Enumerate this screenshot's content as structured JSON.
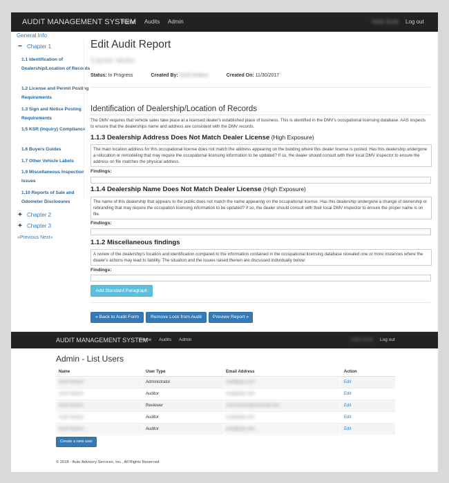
{
  "nav1": {
    "brand": "AUDIT MANAGEMENT SYSTEM",
    "links": [
      "Home",
      "Audits",
      "Admin"
    ],
    "user": "Hello Scott",
    "logout": "Log out"
  },
  "sidebar": {
    "general_info": "General Info",
    "chapter1": {
      "symbol": "−",
      "label": "Chapter 1"
    },
    "items": [
      "1.1 Identification of Dealership/Location of Records",
      "1.2 License and Permit Posting Requirements",
      "1.3 Sign and Notice Posting Requirements",
      "1.5 KSR (Inquiry) Compliance",
      "1.6 Buyers Guides",
      "1.7 Other Vehicle Labels",
      "1.9 Miscellaneous Inspection Issues",
      "1.10 Reports of Sale and Odometer Disclosures"
    ],
    "chapter2": {
      "symbol": "+",
      "label": "Chapter 2"
    },
    "chapter3": {
      "symbol": "+",
      "label": "Chapter 3"
    },
    "previous": "«Previous",
    "next": "Next»"
  },
  "report": {
    "title": "Edit Audit Report",
    "dealer_name": "Carrier Motor",
    "status_label": "Status:",
    "status_value": "In Progress",
    "created_by_label": "Created By:",
    "created_by_value": "Scott Hodson",
    "created_on_label": "Created On:",
    "created_on_value": "11/30/2017",
    "section_title": "Identification of Dealership/Location of Records",
    "section_intro": "The DMV requires that vehicle sales take place at a licensed dealer's established place of business. This is identified in the DMV's occupational licensing database. AAS inspects to ensure that the dealerships name and address are consistent with the DMV records.",
    "findings": [
      {
        "title": "1.1.3 Dealership Address Does Not Match Dealer License",
        "exposure": " (High Exposure)",
        "text": "The main location address for this occupational license does not match the address appearing on the building where this dealer license is posted. Has this dealership undergone a relocation or remodeling that may require the occupational licensing information to be updated? If so, the dealer should consult with their local DMV inspector to ensure the address on file matches the physical address.",
        "label": "Findings:"
      },
      {
        "title": "1.1.4 Dealership Name Does Not Match Dealer License",
        "exposure": " (High Exposure)",
        "text": "The name of this dealership that appears to the public does not match the name appearing on the occupational license. Has this dealership undergone a change of ownership or rebranding that may require the occupation licensing information to be updated? If so, the dealer should consult with their local DMV inspector to ensure the proper name is on file.",
        "label": "Findings:"
      },
      {
        "title": "1.1.2 Miscellaneous findings",
        "exposure": "",
        "text": "A review of the dealership's location and identification compared to the information contained in the occupational licensing database revealed one or more instances where the dealer's actions may lead to liability. The situation and the issues raised therein are discussed individually below:",
        "label": "Findings:"
      }
    ],
    "add_paragraph": "Add Standard Paragraph",
    "back": "« Back to Audit Form",
    "remove_lock": "Remove Lock from Audit",
    "preview": "Preview Report »"
  },
  "nav2": {
    "brand": "AUDIT MANAGEMENT SYSTEM",
    "links": [
      "Home",
      "Audits",
      "Admin"
    ],
    "user": "Hello Scott",
    "logout": "Log out"
  },
  "admin": {
    "title": "Admin - List Users",
    "columns": [
      "Name",
      "User Type",
      "Email Address",
      "Action"
    ],
    "rows": [
      {
        "name": "Scott Hodson",
        "type": "Administrator",
        "email": "scott@aas.com",
        "action": "Edit"
      },
      {
        "name": "Scott Hodson",
        "type": "Auditor",
        "email": "scott@aas.com",
        "action": "Edit"
      },
      {
        "name": "Scott Hodson",
        "type": "Reviewer",
        "email": "scott.hodson@autoaudit.com",
        "action": "Edit"
      },
      {
        "name": "Scott Hodson",
        "type": "Auditor",
        "email": "scott@aas.com",
        "action": "Edit"
      },
      {
        "name": "Scott Hodson",
        "type": "Auditor",
        "email": "scott@aas.com",
        "action": "Edit"
      }
    ],
    "create_button": "Create a new user",
    "footer": "© 2018 - Auto Advisory Services, Inc., All Rights Reserved"
  }
}
